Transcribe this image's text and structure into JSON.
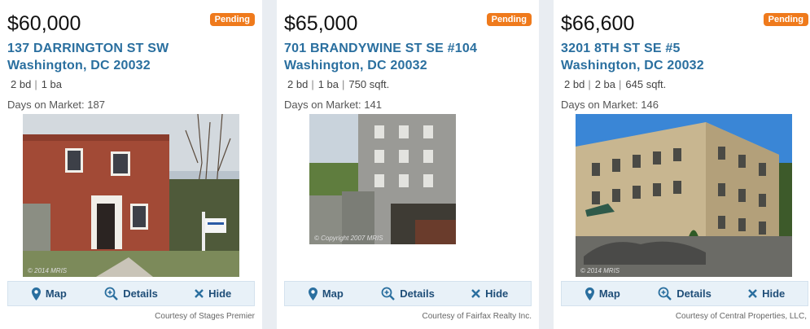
{
  "listings": [
    {
      "price": "$60,000",
      "status": "Pending",
      "address_line1": "137 DARRINGTON ST SW",
      "address_line2": "Washington, DC 20032",
      "beds": "2 bd",
      "baths": "1 ba",
      "sqft": "",
      "days_on_market": "Days on Market: 187",
      "photo_watermark": "© 2014 MRIS",
      "map_label": "Map",
      "details_label": "Details",
      "hide_label": "Hide",
      "courtesy": "Courtesy of Stages Premier"
    },
    {
      "price": "$65,000",
      "status": "Pending",
      "address_line1": "701 BRANDYWINE ST SE #104",
      "address_line2": "Washington, DC 20032",
      "beds": "2 bd",
      "baths": "1 ba",
      "sqft": "750 sqft.",
      "days_on_market": "Days on Market: 141",
      "photo_watermark": "© Copyright 2007 MRIS",
      "map_label": "Map",
      "details_label": "Details",
      "hide_label": "Hide",
      "courtesy": "Courtesy of Fairfax Realty Inc."
    },
    {
      "price": "$66,600",
      "status": "Pending",
      "address_line1": "3201 8TH ST SE #5",
      "address_line2": "Washington, DC 20032",
      "beds": "2 bd",
      "baths": "2 ba",
      "sqft": "645 sqft.",
      "days_on_market": "Days on Market: 146",
      "photo_watermark": "© 2014 MRIS",
      "map_label": "Map",
      "details_label": "Details",
      "hide_label": "Hide",
      "courtesy": "Courtesy of Central Properties, LLC,"
    }
  ],
  "icons": {
    "map": "map-pin-icon",
    "details": "magnify-plus-icon",
    "hide": "close-x-icon"
  },
  "colors": {
    "badge": "#ef7a1c",
    "address": "#2a6f9f",
    "action_text": "#1f4e78",
    "action_bg": "#e8f1f8"
  }
}
